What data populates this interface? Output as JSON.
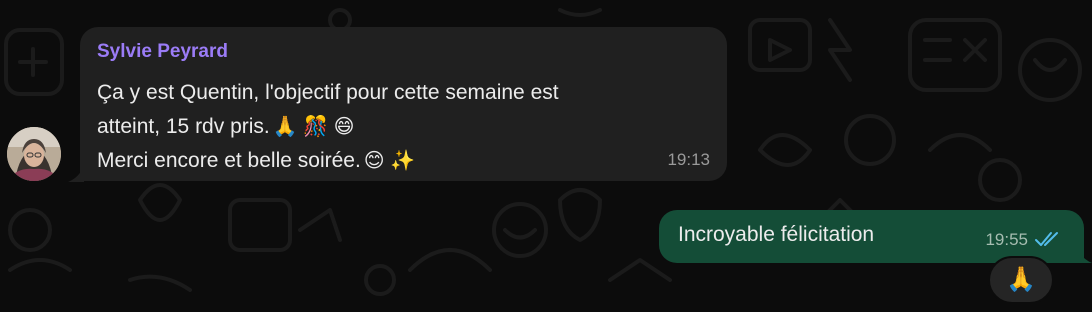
{
  "incoming_message": {
    "sender": "Sylvie Peyrard",
    "lines": [
      "Ça y est Quentin, l'objectif pour cette semaine est",
      "atteint, 15 rdv pris.",
      "Merci encore et belle soirée."
    ],
    "line_emojis": [
      "",
      "🙏 🎊 😄",
      "😊 ✨"
    ],
    "time": "19:13",
    "sender_color": "#9b7cf7",
    "bubble_color": "#202020"
  },
  "outgoing_message": {
    "text": "Incroyable félicitation",
    "time": "19:55",
    "status_icon": "double-check-read-icon",
    "bubble_color": "#144d37",
    "tick_color": "#53bdeb"
  },
  "reaction": {
    "emoji": "🙏"
  },
  "colors": {
    "background": "#0c0c0c",
    "text": "#ececec"
  }
}
